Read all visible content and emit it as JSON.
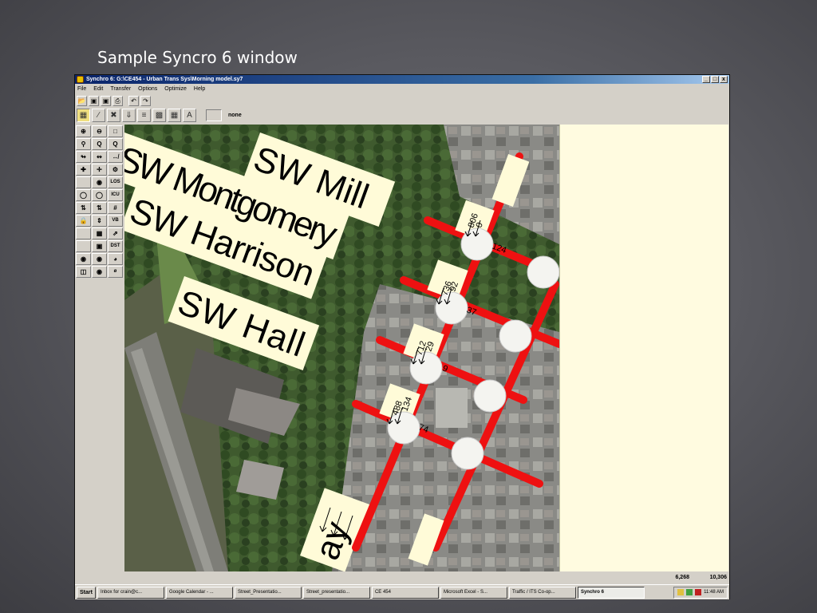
{
  "slide": {
    "title": "Sample Syncro 6 window"
  },
  "window": {
    "title": "Synchro 6: G:\\CE454 - Urban Trans Sys\\Morning model.sy7",
    "controls": [
      "_",
      "□",
      "x"
    ]
  },
  "menu": [
    "File",
    "Edit",
    "Transfer",
    "Options",
    "Optimize",
    "Help"
  ],
  "toolbar2": {
    "selection_label": "none"
  },
  "left_panel": {
    "labels": {
      "los": "LOS",
      "icu": "ICU",
      "vb": "VB",
      "dst": "DST",
      "null": "ø"
    }
  },
  "map": {
    "streets": [
      "SW Mill",
      "SW Montgomery",
      "SW Harrison",
      "SW Hall",
      "ay"
    ],
    "volumes": [
      "806",
      "0",
      "124",
      "736",
      "92",
      "37",
      "712",
      "29",
      "9",
      "488",
      "134",
      "74"
    ]
  },
  "status": {
    "x": "6,268",
    "y": "10,306"
  },
  "taskbar": {
    "start": "Start",
    "tasks": [
      "Inbox for crain@c...",
      "Google Calendar - ...",
      "Street_Presentatio...",
      "Street_presentatio...",
      "CE 454",
      "Microsoft Excel - S...",
      "Traffic / ITS Co-op...",
      "Synchro 6"
    ],
    "clock": "11:48 AM"
  },
  "colors": {
    "title_bar": "#0a246a",
    "road_red": "#ee1111",
    "label_bg": "#fffbd8",
    "canvas_bg": "#fffbe0",
    "aerial": "#4a5a40"
  }
}
